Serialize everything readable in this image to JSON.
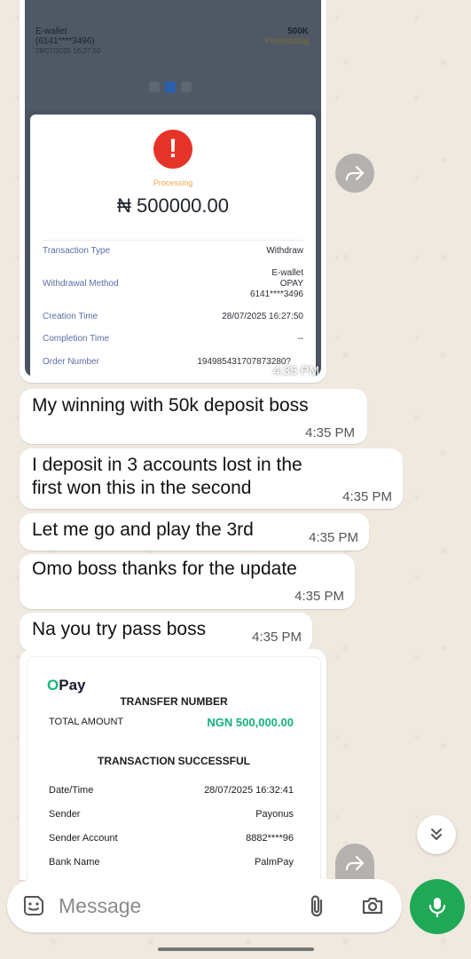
{
  "receipt1": {
    "ewallet_title": "E-wallet",
    "ewallet_account": "(6141****3496)",
    "ewallet_date": "28/07/2025 16:27:50",
    "ewallet_amount": "500K",
    "ewallet_status": "Processing",
    "status": "Processing",
    "amount": "₦ 500000.00",
    "rows": [
      {
        "label": "Transaction Type",
        "value": "Withdraw"
      },
      {
        "label": "Withdrawal Method",
        "value": "E-wallet",
        "value2": "OPAY",
        "value3": "6141****3496"
      },
      {
        "label": "Creation Time",
        "value": "28/07/2025 16:27:50"
      },
      {
        "label": "Completion Time",
        "value": "--"
      },
      {
        "label": "Order Number",
        "value": "194985431707873280?"
      }
    ],
    "timestamp": "4:35 PM"
  },
  "messages": [
    {
      "text": "My winning with 50k deposit boss",
      "time": "4:35 PM"
    },
    {
      "line1": "I deposit in 3 accounts lost in the",
      "line2": "first won this in the second",
      "time": "4:35 PM"
    },
    {
      "text": "Let me go and play the 3rd",
      "time": "4:35 PM"
    },
    {
      "text": "Omo boss thanks for the update",
      "time": "4:35 PM"
    },
    {
      "text": "Na you try pass boss",
      "time": "4:35 PM"
    }
  ],
  "receipt2": {
    "logo_o": "O",
    "logo_pay": "Pay",
    "transfer_number": "TRANSFER NUMBER",
    "total_label": "TOTAL AMOUNT",
    "total_value": "NGN 500,000.00",
    "success": "TRANSACTION SUCCESSFUL",
    "rows": [
      {
        "label": "Date/Time",
        "value": "28/07/2025 16:32:41"
      },
      {
        "label": "Sender",
        "value": "Payonus"
      },
      {
        "label": "Sender Account",
        "value": "8882****96"
      },
      {
        "label": "Bank Name",
        "value": "PalmPay"
      }
    ]
  },
  "composer": {
    "placeholder": "Message"
  },
  "icons": {
    "forward": "forward-icon",
    "scroll_down": "double-chevron-down-icon",
    "sticker": "sticker-icon",
    "attach": "paperclip-icon",
    "camera": "camera-icon",
    "mic": "microphone-icon"
  },
  "colors": {
    "mic_button": "#1fa855",
    "alert": "#e63329",
    "opay_green": "#13b27a"
  }
}
